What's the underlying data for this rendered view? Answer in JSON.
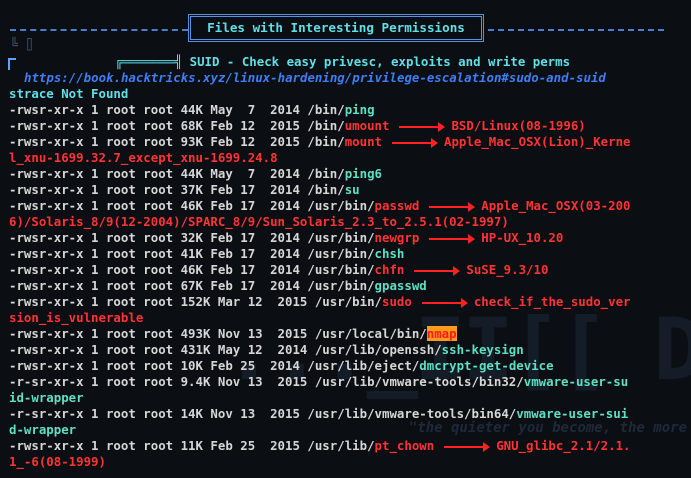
{
  "header": {
    "title": "Files with Interesting Permissions"
  },
  "suid": {
    "title": "SUID - Check easy privesc, exploits and write perms",
    "url": "https://book.hacktricks.xyz/linux-hardening/privilege-escalation#sudo-and-suid"
  },
  "strace": "strace Not Found",
  "colors": {
    "cyan": "#5fe0e8",
    "green": "#5ee0c3",
    "red": "#ff3333",
    "url_blue": "#3f7ef5",
    "highlight": "#ff9a1c"
  },
  "background": {
    "big": "..._II[[ D",
    "quote": "\"the quieter you become, the more"
  },
  "lines": [
    {
      "prefix": "-rwsr-xr-x 1 root root 44K May  7  2014 /bin/",
      "name": "ping",
      "type": "green"
    },
    {
      "prefix": "-rwsr-xr-x 1 root root 68K Feb 12  2015 /bin/",
      "name": "umount",
      "type": "red",
      "note": "BSD/Linux(08-1996)"
    },
    {
      "prefix": "-rwsr-xr-x 1 root root 93K Feb 12  2015 /bin/",
      "name": "mount",
      "type": "red",
      "note": "Apple_Mac_OSX(Lion)_Kerne"
    },
    {
      "text": "l_xnu-1699.32.7_except_xnu-1699.24.8",
      "type": "cont"
    },
    {
      "prefix": "-rwsr-xr-x 1 root root 44K May  7  2014 /bin/",
      "name": "ping6",
      "type": "green"
    },
    {
      "prefix": "-rwsr-xr-x 1 root root 37K Feb 17  2014 /bin/",
      "name": "su",
      "type": "green"
    },
    {
      "prefix": "-rwsr-xr-x 1 root root 46K Feb 17  2014 /usr/bin/",
      "name": "passwd",
      "type": "red",
      "note": "Apple_Mac_OSX(03-200"
    },
    {
      "text": "6)/Solaris_8/9(12-2004)/SPARC_8/9/Sun_Solaris_2.3_to_2.5.1(02-1997)",
      "type": "cont"
    },
    {
      "prefix": "-rwsr-xr-x 1 root root 32K Feb 17  2014 /usr/bin/",
      "name": "newgrp",
      "type": "red",
      "note": "HP-UX_10.20"
    },
    {
      "prefix": "-rwsr-xr-x 1 root root 41K Feb 17  2014 /usr/bin/",
      "name": "chsh",
      "type": "green"
    },
    {
      "prefix": "-rwsr-xr-x 1 root root 46K Feb 17  2014 /usr/bin/",
      "name": "chfn",
      "type": "red",
      "note": "SuSE_9.3/10"
    },
    {
      "prefix": "-rwsr-xr-x 1 root root 67K Feb 17  2014 /usr/bin/",
      "name": "gpasswd",
      "type": "green"
    },
    {
      "prefix": "-rwsr-xr-x 1 root root 152K Mar 12  2015 /usr/bin/",
      "name": "sudo",
      "type": "red",
      "note": "check_if_the_sudo_ver"
    },
    {
      "text": "sion_is_vulnerable",
      "type": "cont"
    },
    {
      "prefix": "-rwsr-xr-x 1 root root 493K Nov 13  2015 /usr/local/bin/",
      "name": "nmap",
      "type": "highlight"
    },
    {
      "prefix": "-rwsr-xr-x 1 root root 431K May 12  2014 /usr/lib/openssh/",
      "name": "ssh-keysign",
      "type": "green"
    },
    {
      "prefix": "-rwsr-xr-x 1 root root 10K Feb 25  2014 /usr/lib/eject/",
      "name": "dmcrypt-get-device",
      "type": "green"
    },
    {
      "prefix": "-r-sr-xr-x 1 root root 9.4K Nov 13  2015 /usr/lib/vmware-tools/bin32/",
      "name": "vmware-user-su",
      "type": "green"
    },
    {
      "text": "id-wrapper",
      "type": "cont-green"
    },
    {
      "prefix": "-r-sr-xr-x 1 root root 14K Nov 13  2015 /usr/lib/vmware-tools/bin64/",
      "name": "vmware-user-sui",
      "type": "green"
    },
    {
      "text": "d-wrapper",
      "type": "cont-green"
    },
    {
      "prefix": "-rwsr-xr-x 1 root root 11K Feb 25  2015 /usr/lib/",
      "name": "pt_chown",
      "type": "red",
      "note": "GNU_glibc_2.1/2.1."
    },
    {
      "text": "1_-6(08-1999)",
      "type": "cont"
    }
  ]
}
